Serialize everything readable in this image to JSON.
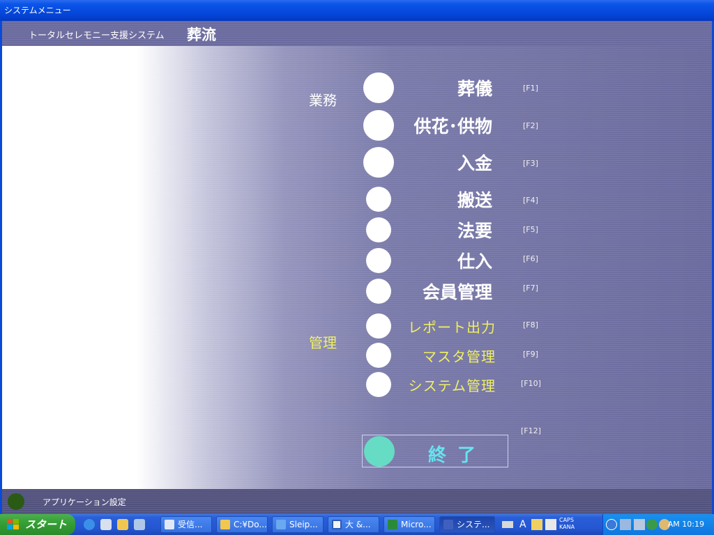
{
  "window": {
    "title": "システムメニュー"
  },
  "header": {
    "subtitle": "トータルセレモニー支援システム",
    "app_name": "葬流"
  },
  "groups": {
    "work": "業務",
    "admin": "管理"
  },
  "menu": [
    {
      "label": "葬儀",
      "key": "[F1]"
    },
    {
      "label": "供花･供物",
      "key": "[F2]"
    },
    {
      "label": "入金",
      "key": "[F3]"
    },
    {
      "label": "搬送",
      "key": "[F4]"
    },
    {
      "label": "法要",
      "key": "[F5]"
    },
    {
      "label": "仕入",
      "key": "[F6]"
    },
    {
      "label": "会員管理",
      "key": "[F7]"
    },
    {
      "label": "レポート出力",
      "key": "[F8]"
    },
    {
      "label": "マスタ管理",
      "key": "[F9]"
    },
    {
      "label": "システム管理",
      "key": "[F10]"
    }
  ],
  "exit": {
    "label": "終了",
    "key": "[F12]"
  },
  "footer": {
    "settings_label": "アプリケーション設定"
  },
  "taskbar": {
    "start_label": "スタート",
    "tasks": [
      "受信...",
      "C:¥Do...",
      "Sleip...",
      "大 &...",
      "Micro...",
      "システ..."
    ],
    "ime": {
      "caps": "CAPS",
      "kana": "KANA"
    },
    "clock": "AM 10:19"
  },
  "colors": {
    "accent_yellow": "#f0f060",
    "exit_teal": "#66dcc4",
    "titlebar_blue": "#0a55e8"
  }
}
